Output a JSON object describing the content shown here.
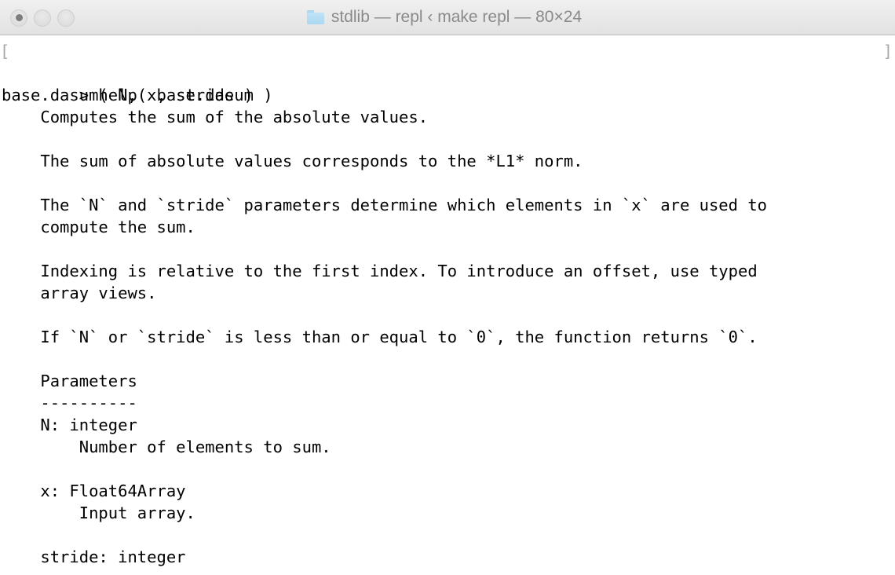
{
  "window": {
    "title": "stdlib — repl ‹ make repl — 80×24",
    "folder_icon": "folder-icon",
    "traffic_lights": [
      {
        "name": "close-button",
        "label": "close"
      },
      {
        "name": "minimize-button",
        "label": "minimize"
      },
      {
        "name": "maximize-button",
        "label": "maximize"
      }
    ],
    "size_label": "80×24"
  },
  "terminal": {
    "prompt_left_marker": "[",
    "prompt_right_marker": "]",
    "prompt_symbol": ">",
    "command": " help( base.dasum )",
    "lines": [
      {
        "text": "base.dasum( N, x, stride )",
        "bold": false
      },
      {
        "text": "    Computes the sum of the absolute values.",
        "bold": false
      },
      {
        "text": "",
        "bold": false
      },
      {
        "text": "    The sum of absolute values corresponds to the *L1* norm.",
        "bold": false
      },
      {
        "text": "",
        "bold": false
      },
      {
        "text": "    The `N` and `stride` parameters determine which elements in `x` are used to",
        "bold": false
      },
      {
        "text": "    compute the sum.",
        "bold": false
      },
      {
        "text": "",
        "bold": false
      },
      {
        "text": "    Indexing is relative to the first index. To introduce an offset, use typed",
        "bold": false
      },
      {
        "text": "    array views.",
        "bold": false
      },
      {
        "text": "",
        "bold": false
      },
      {
        "text": "    If `N` or `stride` is less than or equal to `0`, the function returns `0`.",
        "bold": false
      },
      {
        "text": "",
        "bold": false
      },
      {
        "text": "    Parameters",
        "bold": false
      },
      {
        "text": "    ----------",
        "bold": false
      },
      {
        "text": "    N: integer",
        "bold": false
      },
      {
        "text": "        Number of elements to sum.",
        "bold": false
      },
      {
        "text": "",
        "bold": false
      },
      {
        "text": "    x: Float64Array",
        "bold": false
      },
      {
        "text": "        Input array.",
        "bold": false
      },
      {
        "text": "",
        "bold": false
      },
      {
        "text": "    stride: integer",
        "bold": false
      }
    ]
  },
  "colors": {
    "titlebar_bg": "#e9e9e9",
    "titlebar_text": "#8a8a8a",
    "terminal_bg": "#ffffff",
    "terminal_text": "#000000",
    "folder_blue": "#a9d8f0",
    "marker_gray": "#a8a8a8"
  }
}
